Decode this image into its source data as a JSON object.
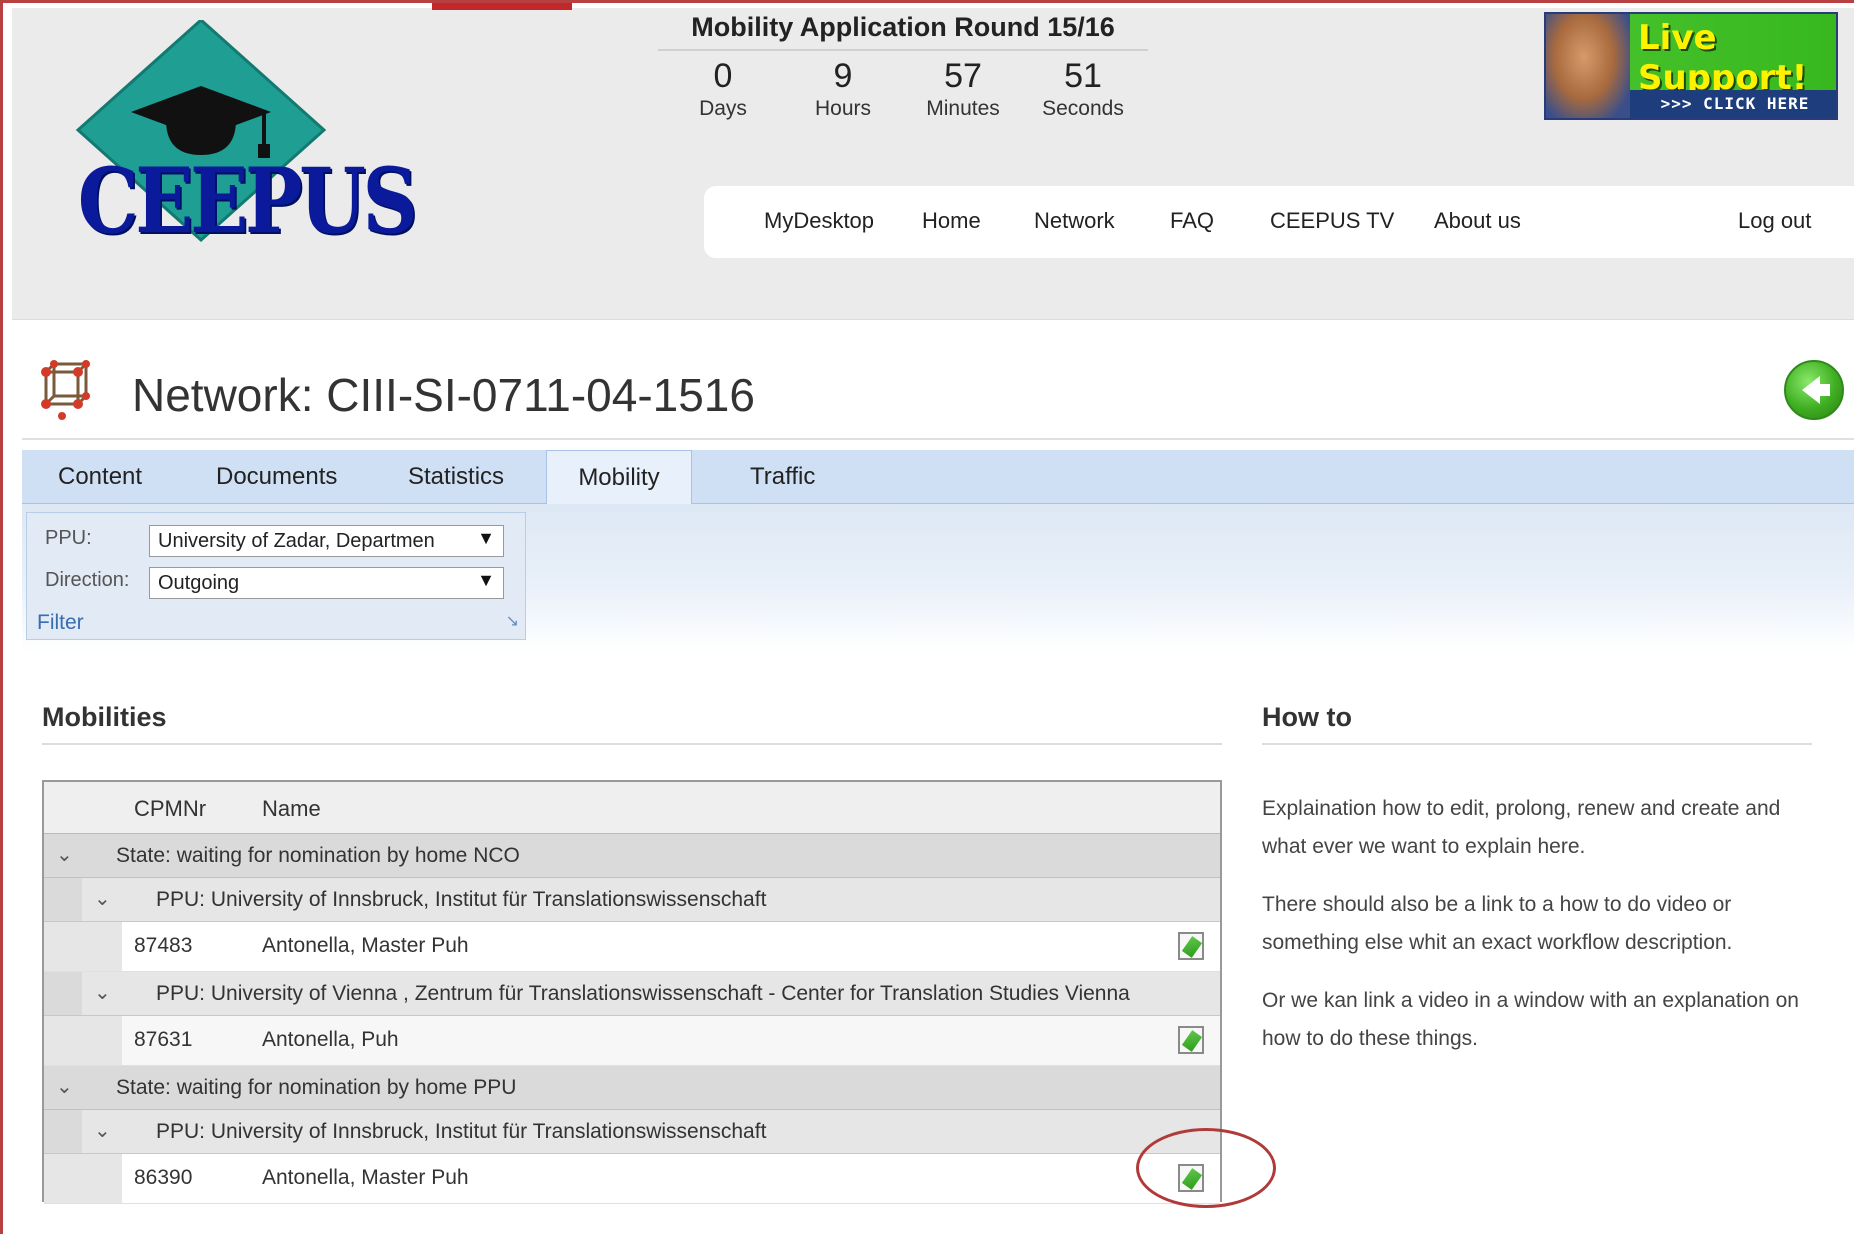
{
  "header": {
    "logo_text": "CEEPUS",
    "countdown": {
      "title": "Mobility Application Round 15/16",
      "units": [
        {
          "value": "0",
          "label": "Days"
        },
        {
          "value": "9",
          "label": "Hours"
        },
        {
          "value": "57",
          "label": "Minutes"
        },
        {
          "value": "51",
          "label": "Seconds"
        }
      ]
    },
    "live_support": {
      "title": "Live Support!",
      "cta": ">>> CLICK HERE"
    },
    "nav": [
      "MyDesktop",
      "Home",
      "Network",
      "FAQ",
      "CEEPUS TV",
      "About us"
    ],
    "logout": "Log out"
  },
  "page": {
    "title": "Network: CIII-SI-0711-04-1516",
    "tabs": [
      "Content",
      "Documents",
      "Statistics",
      "Mobility",
      "Traffic"
    ],
    "active_tab": "Mobility"
  },
  "filter": {
    "ppu_label": "PPU:",
    "ppu_value": "University of Zadar, Departmen",
    "direction_label": "Direction:",
    "direction_value": "Outgoing",
    "caption": "Filter"
  },
  "mobilities": {
    "heading": "Mobilities",
    "columns": [
      "CPMNr",
      "Name"
    ],
    "groups": [
      {
        "state": "State: waiting for nomination by home NCO"
      },
      {
        "ppu": "PPU: University of Innsbruck, Institut für Translationswissenschaft"
      },
      {
        "nr": "87483",
        "name": "Antonella, Master Puh"
      },
      {
        "ppu": "PPU: University of Vienna , Zentrum für Translationswissenschaft - Center for Translation Studies Vienna"
      },
      {
        "nr": "87631",
        "name": "Antonella, Puh"
      },
      {
        "state": "State: waiting for nomination by home PPU"
      },
      {
        "ppu": "PPU: University of Innsbruck, Institut für Translationswissenschaft"
      },
      {
        "nr": "86390",
        "name": "Antonella, Master Puh"
      }
    ]
  },
  "howto": {
    "heading": "How to",
    "paragraphs": [
      "Explaination how to edit, prolong, renew and create and what ever we want to explain here.",
      "There should also be a link to a how to do video or something else whit an exact workflow description.",
      "Or we kan link a video in a window with an explanation on how to do these things."
    ]
  }
}
